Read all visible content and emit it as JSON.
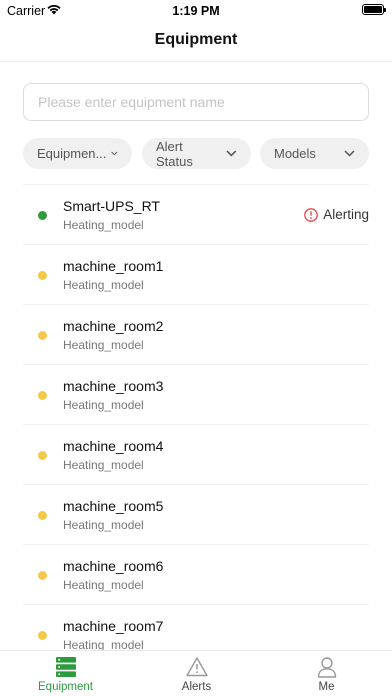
{
  "status_bar": {
    "carrier": "Carrier",
    "time": "1:19 PM"
  },
  "nav": {
    "title": "Equipment"
  },
  "search": {
    "placeholder": "Please enter equipment name",
    "value": ""
  },
  "filters": [
    {
      "label": "Equipmen..."
    },
    {
      "label": "Alert Status"
    },
    {
      "label": "Models"
    }
  ],
  "colors": {
    "accent": "#2e9a3e",
    "status_online": "#2e9a3e",
    "status_warning": "#f3c94a",
    "alert_red": "#e5484d",
    "inactive_tab": "#999999"
  },
  "equipment": [
    {
      "name": "Smart-UPS_RT",
      "model": "Heating_model",
      "status": "online",
      "alert": "Alerting"
    },
    {
      "name": "machine_room1",
      "model": "Heating_model",
      "status": "warning"
    },
    {
      "name": "machine_room2",
      "model": "Heating_model",
      "status": "warning"
    },
    {
      "name": "machine_room3",
      "model": "Heating_model",
      "status": "warning"
    },
    {
      "name": "machine_room4",
      "model": "Heating_model",
      "status": "warning"
    },
    {
      "name": "machine_room5",
      "model": "Heating_model",
      "status": "warning"
    },
    {
      "name": "machine_room6",
      "model": "Heating_model",
      "status": "warning"
    },
    {
      "name": "machine_room7",
      "model": "Heating_model",
      "status": "warning"
    }
  ],
  "tabs": [
    {
      "label": "Equipment",
      "icon": "server-icon",
      "active": true
    },
    {
      "label": "Alerts",
      "icon": "warning-triangle-icon",
      "active": false
    },
    {
      "label": "Me",
      "icon": "user-icon",
      "active": false
    }
  ]
}
